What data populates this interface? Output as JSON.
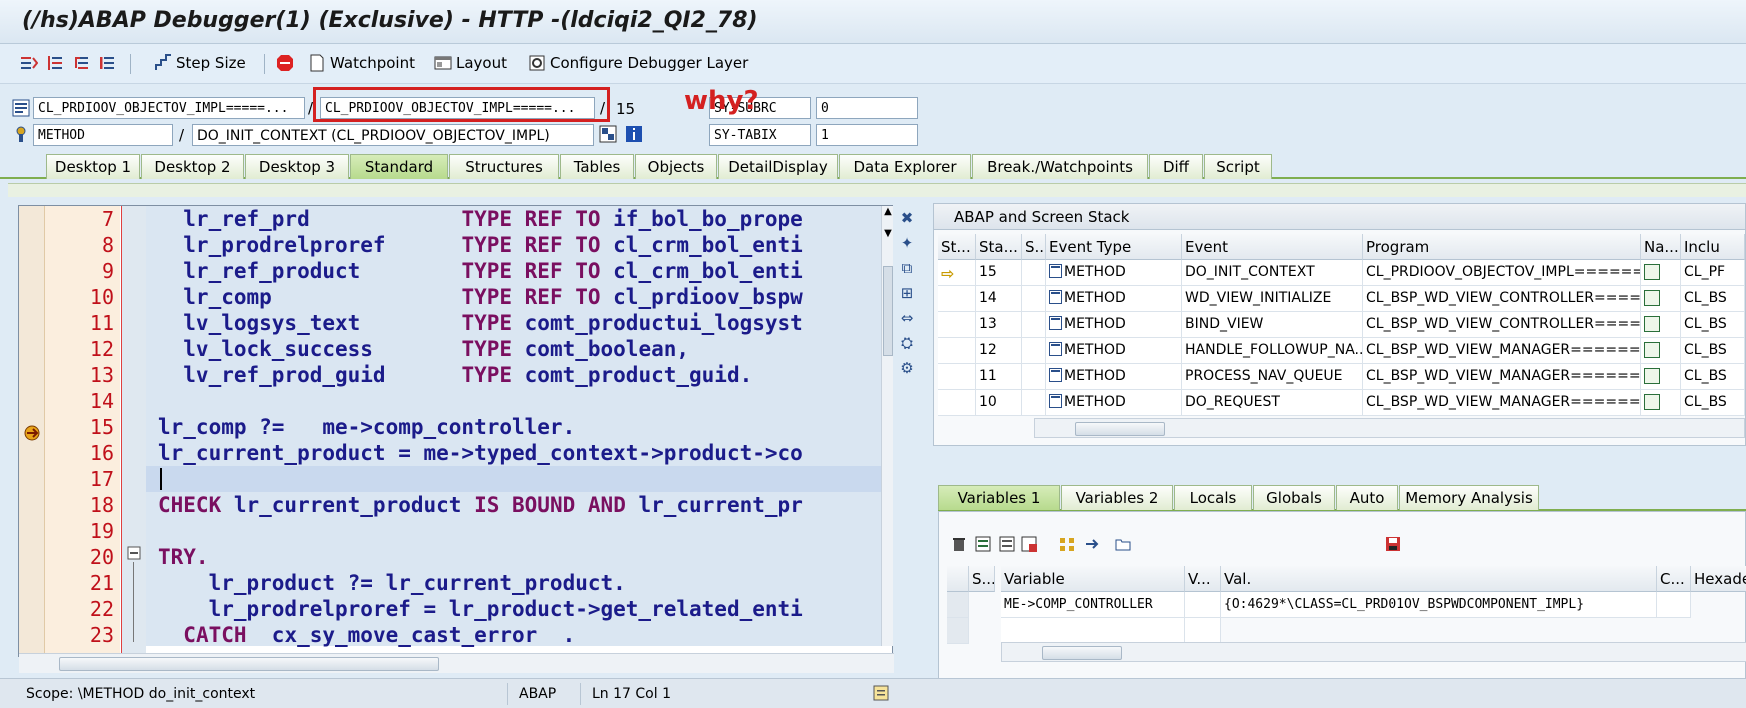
{
  "window": {
    "title": "(/hs)ABAP Debugger(1)  (Exclusive) - HTTP -(ldciqi2_QI2_78)"
  },
  "toolbar": {
    "step_size": "Step Size",
    "watchpoint": "Watchpoint",
    "layout": "Layout",
    "configure": "Configure Debugger Layer"
  },
  "context": {
    "program": "CL_PRDIOOV_OBJECTOV_IMPL=====...",
    "include": "CL_PRDIOOV_OBJECTOV_IMPL=====...",
    "line": "15",
    "type": "METHOD",
    "method": "DO_INIT_CONTEXT (CL_PRDIOOV_OBJECTOV_IMPL)",
    "sys1_label": "SY-SUBRC",
    "sys1_value": "0",
    "sys2_label": "SY-TABIX",
    "sys2_value": "1",
    "sep": "/"
  },
  "annotation": {
    "why": "why?"
  },
  "tabs": [
    "Desktop 1",
    "Desktop 2",
    "Desktop 3",
    "Standard",
    "Structures",
    "Tables",
    "Objects",
    "DetailDisplay",
    "Data Explorer",
    "Break./Watchpoints",
    "Diff",
    "Script"
  ],
  "active_tab": "Standard",
  "code": {
    "lines": [
      {
        "n": "7",
        "text": "  lr_ref_prd            TYPE REF TO if_bol_bo_prope"
      },
      {
        "n": "8",
        "text": "  lr_prodrelproref      TYPE REF TO cl_crm_bol_enti"
      },
      {
        "n": "9",
        "text": "  lr_ref_product        TYPE REF TO cl_crm_bol_enti"
      },
      {
        "n": "10",
        "text": "  lr_comp               TYPE REF TO cl_prdioov_bspw"
      },
      {
        "n": "11",
        "text": "  lv_logsys_text        TYPE comt_productui_logsyst"
      },
      {
        "n": "12",
        "text": "  lv_lock_success       TYPE comt_boolean,"
      },
      {
        "n": "13",
        "text": "  lv_ref_prod_guid      TYPE comt_product_guid."
      },
      {
        "n": "14",
        "text": ""
      },
      {
        "n": "15",
        "text": "lr_comp ?=   me->comp_controller."
      },
      {
        "n": "16",
        "text": "lr_current_product = me->typed_context->product->co"
      },
      {
        "n": "17",
        "text": ""
      },
      {
        "n": "18",
        "text": "CHECK lr_current_product IS BOUND AND lr_current_pr"
      },
      {
        "n": "19",
        "text": ""
      },
      {
        "n": "20",
        "text": "TRY."
      },
      {
        "n": "21",
        "text": "    lr_product ?= lr_current_product."
      },
      {
        "n": "22",
        "text": "    lr_prodrelproref = lr_product->get_related_enti"
      },
      {
        "n": "23",
        "text": "  CATCH  cx_sy_move_cast_error  ."
      }
    ]
  },
  "status": {
    "scope": "Scope: \\METHOD do_init_context",
    "lang": "ABAP",
    "pos": "Ln  17 Col  1"
  },
  "stack": {
    "title": "ABAP and Screen Stack",
    "columns": [
      "St...",
      "Sta...",
      "S...",
      "Event Type",
      "Event",
      "Program",
      "Na...",
      "Inclu"
    ],
    "rows": [
      {
        "level": "15",
        "type": "METHOD",
        "event": "DO_INIT_CONTEXT",
        "program": "CL_PRDIOOV_OBJECTOV_IMPL======...",
        "incl": "CL_PF"
      },
      {
        "level": "14",
        "type": "METHOD",
        "event": "WD_VIEW_INITIALIZE",
        "program": "CL_BSP_WD_VIEW_CONTROLLER====...",
        "incl": "CL_BS"
      },
      {
        "level": "13",
        "type": "METHOD",
        "event": "BIND_VIEW",
        "program": "CL_BSP_WD_VIEW_CONTROLLER====...",
        "incl": "CL_BS"
      },
      {
        "level": "12",
        "type": "METHOD",
        "event": "HANDLE_FOLLOWUP_NA...",
        "program": "CL_BSP_WD_VIEW_MANAGER======...",
        "incl": "CL_BS"
      },
      {
        "level": "11",
        "type": "METHOD",
        "event": "PROCESS_NAV_QUEUE",
        "program": "CL_BSP_WD_VIEW_MANAGER======...",
        "incl": "CL_BS"
      },
      {
        "level": "10",
        "type": "METHOD",
        "event": "DO_REQUEST",
        "program": "CL_BSP_WD_VIEW_MANAGER======...",
        "incl": "CL_BS"
      }
    ]
  },
  "var_tabs": [
    "Variables 1",
    "Variables 2",
    "Locals",
    "Globals",
    "Auto",
    "Memory Analysis"
  ],
  "active_var_tab": "Variables 1",
  "vars": {
    "columns": [
      "S...",
      "Variable",
      "V...",
      "Val.",
      "C...",
      "Hexade"
    ],
    "rows": [
      {
        "variable": "ME->COMP_CONTROLLER",
        "value": "{O:4629*\\CLASS=CL_PRD01OV_BSPWDCOMPONENT_IMPL}"
      }
    ]
  }
}
